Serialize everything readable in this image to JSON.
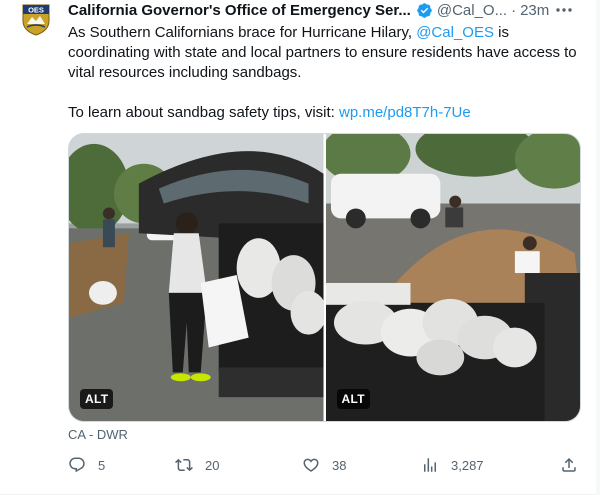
{
  "tweet": {
    "author": {
      "display_name": "California Governor's Office of Emergency Ser...",
      "handle": "@Cal_O...",
      "verified": true,
      "avatar_text": "OES",
      "avatar_icon": "cal-oes-shield-logo"
    },
    "separator": "·",
    "time": "23m",
    "more_icon": "more-horizontal-icon",
    "text": {
      "part1": "As Southern Californians brace for Hurricane Hilary, ",
      "mention": "@Cal_OES",
      "part2": " is coordinating with state and local partners to ensure residents have access to vital resources including sandbags.",
      "part3": "To learn about sandbag safety tips, visit: ",
      "url": "wp.me/pd8T7h-7Ue"
    },
    "media": [
      {
        "alt_label": "ALT",
        "subject": "woman carrying sandbag to SUV"
      },
      {
        "alt_label": "ALT",
        "subject": "sandbags loaded in pickup truck bed"
      }
    ],
    "media_credit": "CA - DWR",
    "actions": {
      "reply": {
        "icon": "reply-icon",
        "count": "5"
      },
      "retweet": {
        "icon": "retweet-icon",
        "count": "20"
      },
      "like": {
        "icon": "heart-icon",
        "count": "38"
      },
      "views": {
        "icon": "views-icon",
        "count": "3,287"
      },
      "share": {
        "icon": "share-icon"
      }
    },
    "colors": {
      "link": "#1d9bf0",
      "secondary_text": "#536471",
      "verified": "#1d9bf0"
    }
  }
}
